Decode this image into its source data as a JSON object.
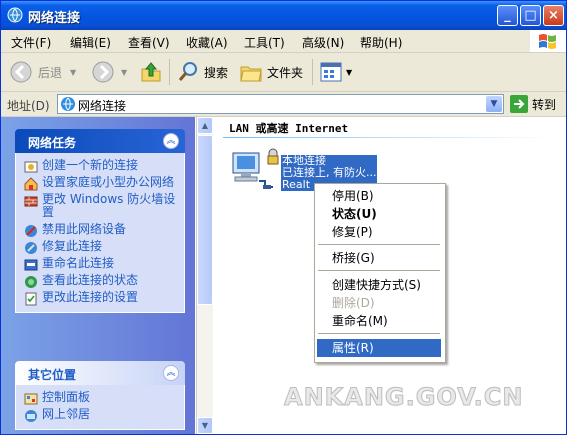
{
  "window": {
    "title": "网络连接",
    "minimize_glyph": "_",
    "maximize_glyph": "□",
    "close_glyph": "×"
  },
  "menubar": {
    "items": [
      "文件(F)",
      "编辑(E)",
      "查看(V)",
      "收藏(A)",
      "工具(T)",
      "高级(N)",
      "帮助(H)"
    ]
  },
  "toolbar": {
    "back_label": "后退",
    "search_label": "搜索",
    "folders_label": "文件夹"
  },
  "address": {
    "label": "地址(D)",
    "value": "网络连接",
    "go_label": "转到"
  },
  "taskpane": {
    "network_tasks": {
      "title": "网络任务",
      "items": [
        {
          "label": "创建一个新的连接",
          "icon": "new-connection-icon"
        },
        {
          "label": "设置家庭或小型办公网络",
          "icon": "home-network-icon"
        },
        {
          "label": "更改 Windows 防火墙设置",
          "icon": "firewall-icon"
        },
        {
          "label": "禁用此网络设备",
          "icon": "disable-device-icon"
        },
        {
          "label": "修复此连接",
          "icon": "repair-icon"
        },
        {
          "label": "重命名此连接",
          "icon": "rename-icon"
        },
        {
          "label": "查看此连接的状态",
          "icon": "status-icon"
        },
        {
          "label": "更改此连接的设置",
          "icon": "settings-icon"
        }
      ]
    },
    "other_places": {
      "title": "其它位置",
      "items": [
        {
          "label": "控制面板",
          "icon": "control-panel-icon"
        },
        {
          "label": "网上邻居",
          "icon": "network-places-icon"
        }
      ]
    }
  },
  "content": {
    "section_header": "LAN 或高速 Internet",
    "connection": {
      "name": "本地连接",
      "status": "已连接上, 有防火...",
      "device": "Realt"
    }
  },
  "context_menu": {
    "items": [
      {
        "label": "停用(B)",
        "style": "normal"
      },
      {
        "label": "状态(U)",
        "style": "bold"
      },
      {
        "label": "修复(P)",
        "style": "normal"
      },
      {
        "label": "桥接(G)",
        "style": "normal"
      },
      {
        "label": "创建快捷方式(S)",
        "style": "normal"
      },
      {
        "label": "删除(D)",
        "style": "disabled"
      },
      {
        "label": "重命名(M)",
        "style": "normal"
      },
      {
        "label": "属性(R)",
        "style": "selected"
      }
    ]
  },
  "watermark": "ANKANG.GOV.CN",
  "colors": {
    "title_blue": "#0454e0",
    "selection": "#316ac5",
    "task_link": "#215dc6",
    "pane_bg": "#6375d6"
  }
}
